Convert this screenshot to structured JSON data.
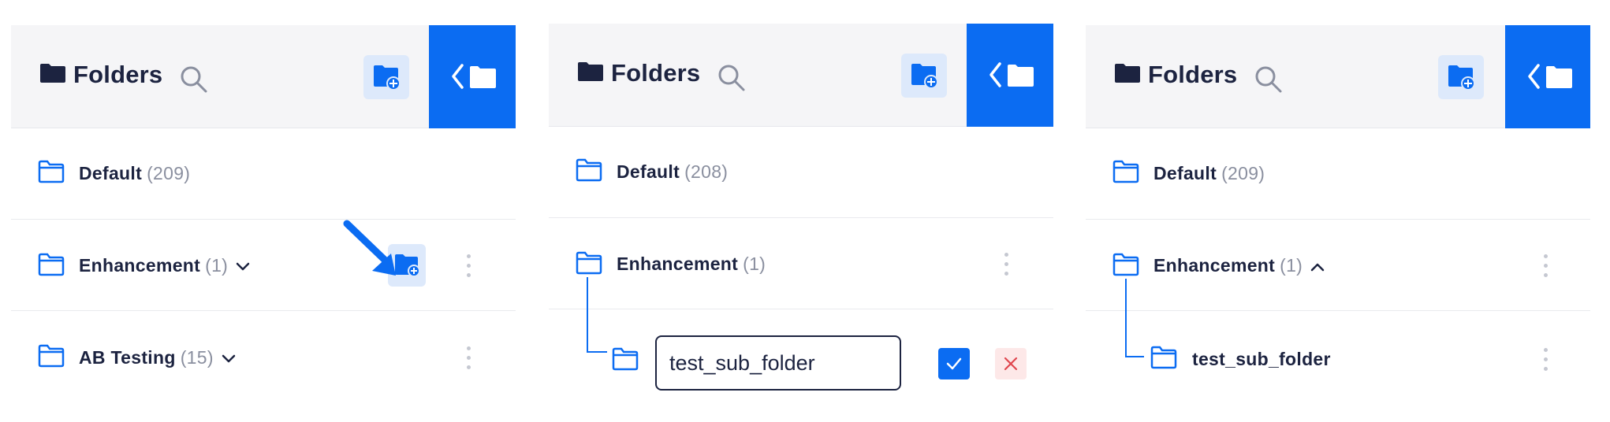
{
  "colors": {
    "accent": "#0b6cf2",
    "accent_light": "#dde9fb",
    "text": "#1c2340",
    "muted": "#8a8f9f",
    "header_bg": "#f5f5f7",
    "danger_bg": "#fde8e8",
    "danger": "#e0464e"
  },
  "panel1": {
    "title": "Folders",
    "rows": [
      {
        "name": "Default",
        "count": "(209)"
      },
      {
        "name": "Enhancement",
        "count": "(1)"
      },
      {
        "name": "AB Testing",
        "count": "(15)"
      }
    ]
  },
  "panel2": {
    "title": "Folders",
    "rows": [
      {
        "name": "Default",
        "count": "(208)"
      },
      {
        "name": "Enhancement",
        "count": "(1)"
      }
    ],
    "new_folder_input": {
      "value": "test_sub_folder"
    }
  },
  "panel3": {
    "title": "Folders",
    "rows": [
      {
        "name": "Default",
        "count": "(209)"
      },
      {
        "name": "Enhancement",
        "count": "(1)"
      },
      {
        "name": "test_sub_folder",
        "count": ""
      }
    ]
  }
}
